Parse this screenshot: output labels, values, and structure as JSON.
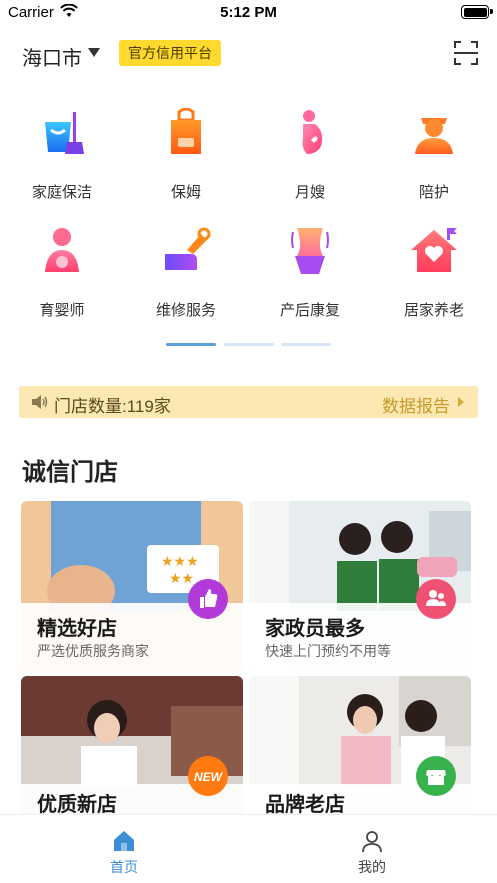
{
  "status_bar": {
    "carrier": "Carrier",
    "time": "5:12 PM"
  },
  "header": {
    "city": "海口市",
    "badge": "官方信用平台",
    "scan_icon": "scan-icon"
  },
  "services": [
    {
      "label": "家庭保洁",
      "icon": "cleaning-bucket-icon"
    },
    {
      "label": "保姆",
      "icon": "apron-icon"
    },
    {
      "label": "月嫂",
      "icon": "pregnant-woman-icon"
    },
    {
      "label": "陪护",
      "icon": "caregiver-icon"
    },
    {
      "label": "育婴师",
      "icon": "baby-care-icon"
    },
    {
      "label": "维修服务",
      "icon": "wrench-hand-icon"
    },
    {
      "label": "产后康复",
      "icon": "waist-icon"
    },
    {
      "label": "居家养老",
      "icon": "house-heart-icon"
    }
  ],
  "pager": {
    "pages": 3,
    "active": 0
  },
  "notice": {
    "text": "门店数量:119家",
    "link": "数据报告"
  },
  "section_title": "诚信门店",
  "cards": [
    {
      "title": "精选好店",
      "subtitle": "严选优质服务商家",
      "badge_icon": "thumbs-up-icon",
      "badge_color": "#b23ad8"
    },
    {
      "title": "家政员最多",
      "subtitle": "快速上门预约不用等",
      "badge_icon": "people-icon",
      "badge_color": "#ef5173"
    },
    {
      "title": "优质新店",
      "subtitle": "",
      "badge_text": "NEW",
      "badge_color": "#ff7a10"
    },
    {
      "title": "品牌老店",
      "subtitle": "",
      "badge_icon": "shop-icon",
      "badge_color": "#37b24d"
    }
  ],
  "tabs": [
    {
      "label": "首页",
      "icon": "home-icon",
      "active": true,
      "color": "#3c8fd6"
    },
    {
      "label": "我的",
      "icon": "user-icon",
      "active": false,
      "color": "#444444"
    }
  ]
}
